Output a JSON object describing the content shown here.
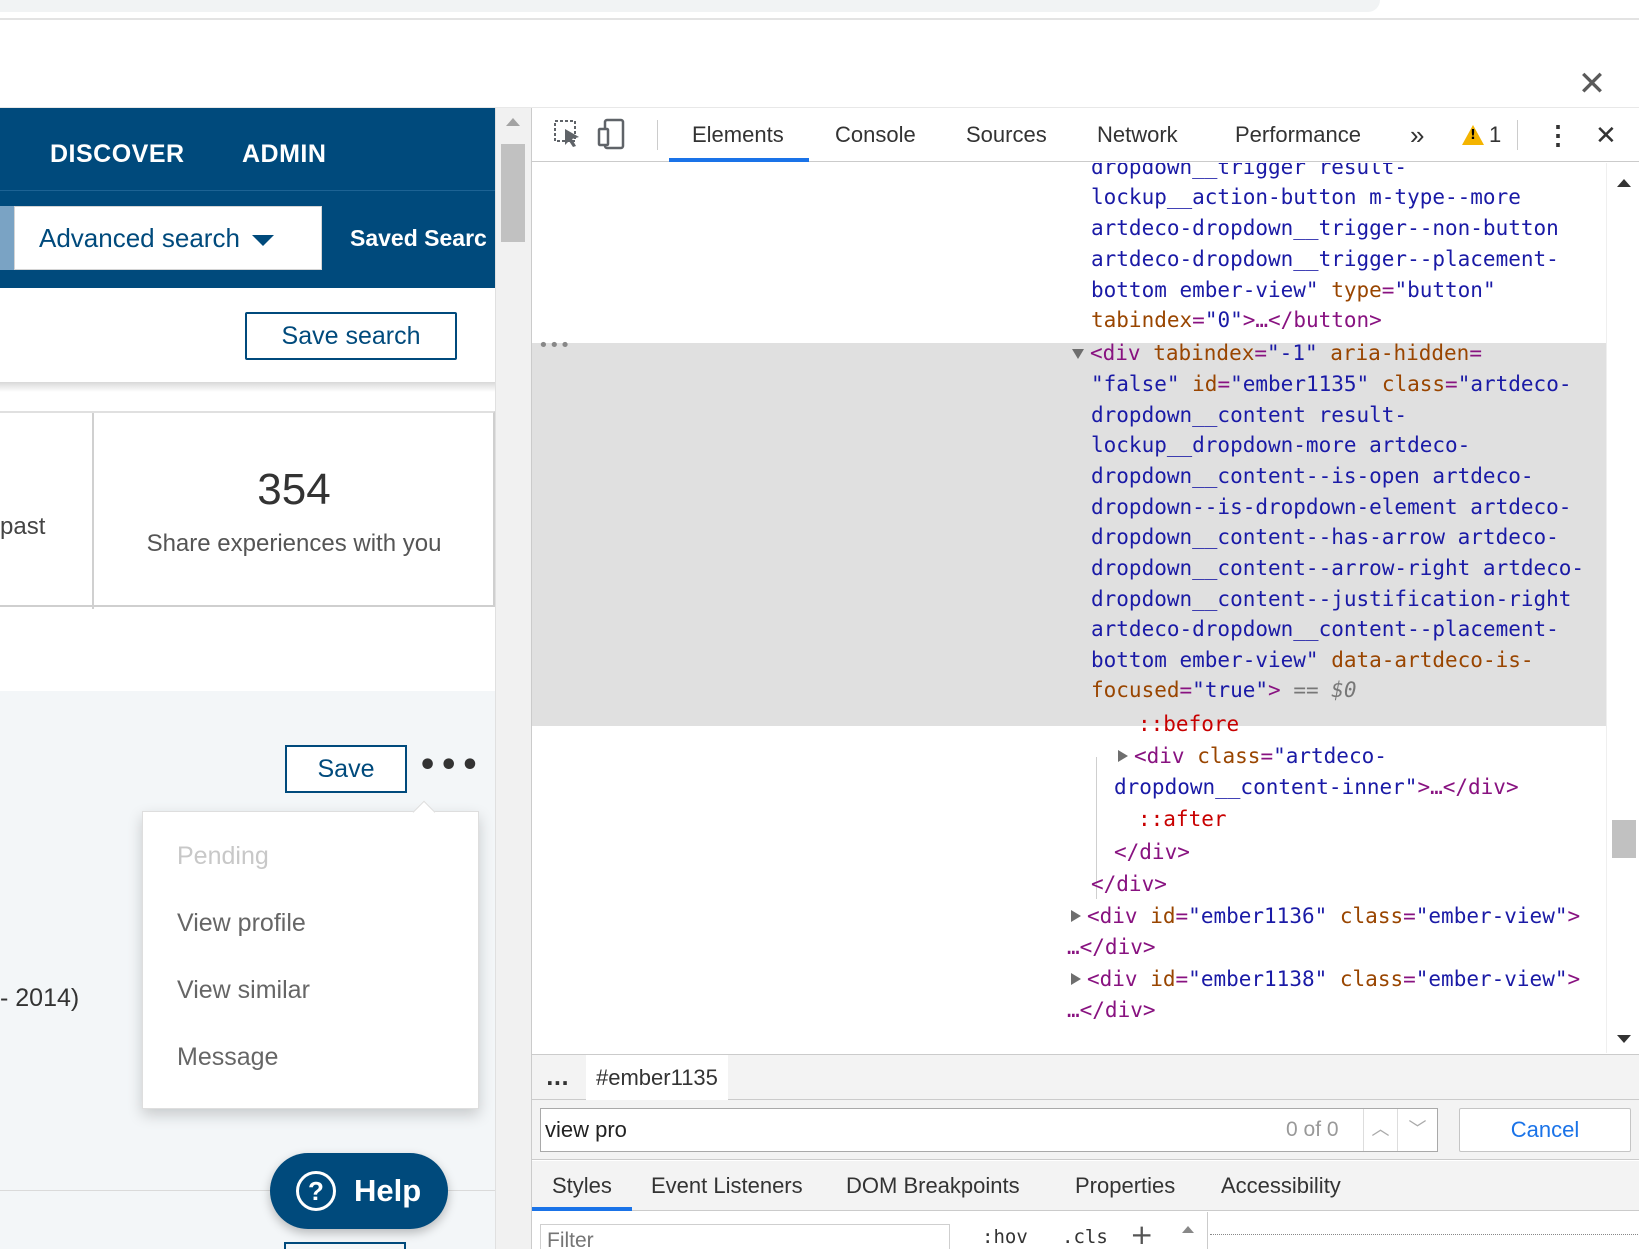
{
  "window": {
    "close_glyph": "✕"
  },
  "nav": {
    "discover": "DISCOVER",
    "admin": "ADMIN",
    "advanced_search": "Advanced search",
    "saved_searches": "Saved Searc"
  },
  "actions": {
    "save_search": "Save search",
    "save": "Save",
    "more": "•••"
  },
  "stats": {
    "past_label": "past",
    "share_number": "354",
    "share_label": "Share experiences with you"
  },
  "result": {
    "years_fragment": "- 2014)"
  },
  "menu": {
    "items": [
      {
        "label": "Pending",
        "disabled": true
      },
      {
        "label": "View profile",
        "disabled": false
      },
      {
        "label": "View similar",
        "disabled": false
      },
      {
        "label": "Message",
        "disabled": false
      }
    ]
  },
  "help": {
    "label": "Help",
    "icon": "?"
  },
  "devtools": {
    "tabs": [
      "Elements",
      "Console",
      "Sources",
      "Network",
      "Performance"
    ],
    "active_tab": "Elements",
    "overflow": "»",
    "warning_count": "1",
    "warning_glyph": "!",
    "menu_glyph": "⋮",
    "close_glyph": "✕",
    "code": {
      "l0": "dropdown__trigger result-",
      "l1": "lockup__action-button m-type--more",
      "l2": "artdeco-dropdown__trigger--non-button",
      "l3": "artdeco-dropdown__trigger--placement-",
      "l4a": "bottom ember-view\"",
      "l4b": " type",
      "l4c": "=",
      "l4d": "\"button\"",
      "l5a": "tabindex",
      "l5b": "=",
      "l5c": "\"0\"",
      "l5d": ">…</button>",
      "l6a": "<div",
      "l6b": " tabindex",
      "l6c": "=",
      "l6d": "\"-1\"",
      "l6e": " aria-hidden",
      "l6f": "=",
      "l7a": "\"false\"",
      "l7b": " id",
      "l7c": "=",
      "l7d": "\"ember1135\"",
      "l7e": " class",
      "l7f": "=",
      "l7g": "\"artdeco-",
      "l8": "dropdown__content result-",
      "l9": "lockup__dropdown-more artdeco-",
      "l10": "dropdown__content--is-open artdeco-",
      "l11": "dropdown--is-dropdown-element artdeco-",
      "l12": "dropdown__content--has-arrow artdeco-",
      "l13": "dropdown__content--arrow-right artdeco-",
      "l14": "dropdown__content--justification-right",
      "l15": "artdeco-dropdown__content--placement-",
      "l16a": "bottom ember-view\"",
      "l16b": " data-artdeco-is-",
      "l17a": "focused",
      "l17b": "=",
      "l17c": "\"true\"",
      "l17d": ">",
      "l17e": " == $0",
      "l18": "::before",
      "l19a": "<div",
      "l19b": " class",
      "l19c": "=",
      "l19d": "\"artdeco-",
      "l20a": "dropdown__content-inner\"",
      "l20b": ">…</div>",
      "l21": "::after",
      "l22": "</div>",
      "l23": "</div>",
      "l24a": "<div",
      "l24b": " id",
      "l24c": "=",
      "l24d": "\"ember1136\"",
      "l24e": " class",
      "l24f": "=",
      "l24g": "\"ember-view\"",
      "l24h": ">",
      "l25": "…</div>",
      "l26a": "<div",
      "l26b": " id",
      "l26c": "=",
      "l26d": "\"ember1138\"",
      "l26e": " class",
      "l26f": "=",
      "l26g": "\"ember-view\"",
      "l26h": ">",
      "l27": "…</div>",
      "row_dots": "•••"
    },
    "breadcrumb": {
      "dots": "...",
      "item": "#ember1135"
    },
    "search": {
      "value": "view pro",
      "count": "0 of 0",
      "cancel": "Cancel",
      "up_glyph": "︿",
      "down_glyph": "﹀"
    },
    "subtabs": [
      "Styles",
      "Event Listeners",
      "DOM Breakpoints",
      "Properties",
      "Accessibility"
    ],
    "filter": {
      "placeholder": "Filter",
      "hov": ":hov",
      "cls": ".cls",
      "plus": "+"
    }
  }
}
